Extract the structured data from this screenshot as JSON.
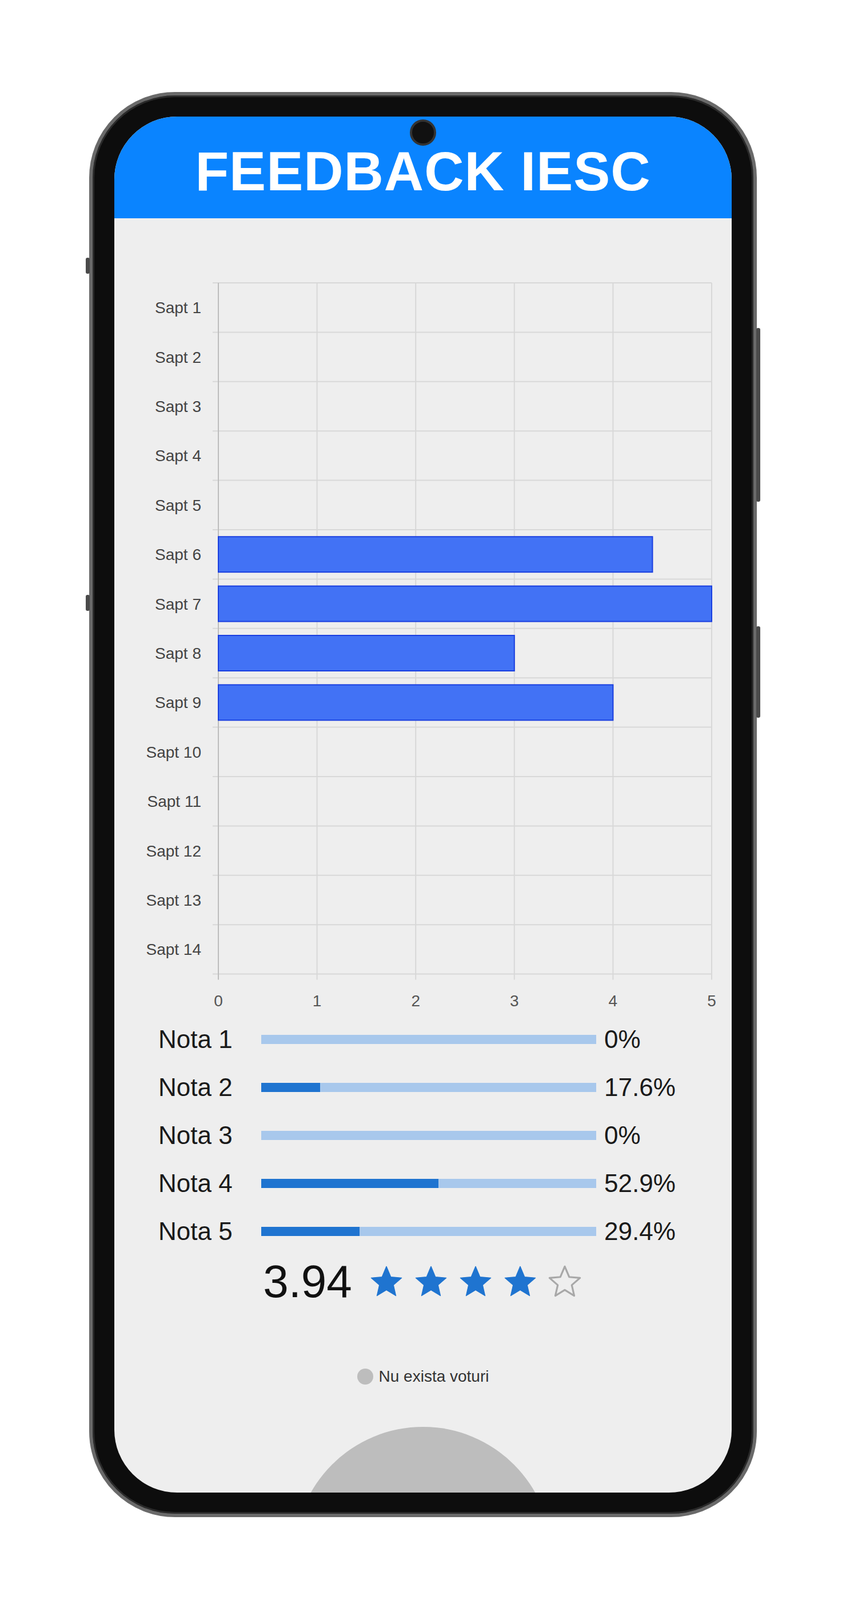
{
  "header": {
    "title": "FEEDBACK IESC"
  },
  "chart": {
    "categories": [
      "Sapt 1",
      "Sapt 2",
      "Sapt 3",
      "Sapt 4",
      "Sapt 5",
      "Sapt 6",
      "Sapt 7",
      "Sapt 8",
      "Sapt 9",
      "Sapt 10",
      "Sapt 11",
      "Sapt 12",
      "Sapt 13",
      "Sapt 14"
    ],
    "ticks": [
      "0",
      "1",
      "2",
      "3",
      "4",
      "5"
    ],
    "series": [
      {
        "values": [
          0,
          0,
          0,
          0,
          0,
          4.4,
          5,
          3,
          4,
          0,
          0,
          0,
          0,
          0
        ]
      }
    ]
  },
  "ratings": [
    {
      "label": "Nota 1",
      "level": 0,
      "reading": "0%"
    },
    {
      "label": "Nota 2",
      "level": 0.176,
      "reading": "17.6%"
    },
    {
      "label": "Nota 3",
      "level": 0,
      "reading": "0%"
    },
    {
      "label": "Nota 4",
      "level": 0.529,
      "reading": "52.9%"
    },
    {
      "label": "Nota 5",
      "level": 0.294,
      "reading": "29.4%"
    }
  ],
  "average": {
    "value": "3.94",
    "stars": 4
  },
  "pie": {
    "legend": {
      "label": "Nu exista voturi"
    }
  }
}
